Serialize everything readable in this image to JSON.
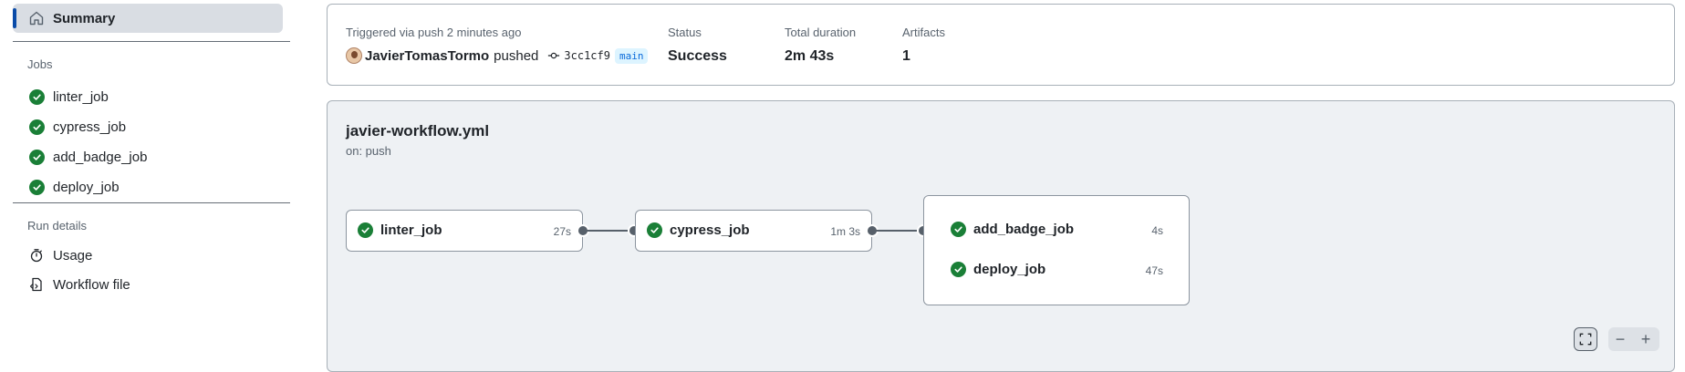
{
  "sidebar": {
    "summary_label": "Summary",
    "jobs_heading": "Jobs",
    "jobs": [
      {
        "label": "linter_job"
      },
      {
        "label": "cypress_job"
      },
      {
        "label": "add_badge_job"
      },
      {
        "label": "deploy_job"
      }
    ],
    "run_details_heading": "Run details",
    "run_details": [
      {
        "label": "Usage",
        "icon": "stopwatch-icon"
      },
      {
        "label": "Workflow file",
        "icon": "file-code-icon"
      }
    ]
  },
  "header": {
    "trigger_text": "Triggered via push 2 minutes ago",
    "actor": "JavierTomasTormo",
    "action": "pushed",
    "commit_sha": "3cc1cf9",
    "branch": "main",
    "status_label": "Status",
    "status_value": "Success",
    "duration_label": "Total duration",
    "duration_value": "2m 43s",
    "artifacts_label": "Artifacts",
    "artifacts_value": "1"
  },
  "graph": {
    "workflow_name": "javier-workflow.yml",
    "trigger": "on: push",
    "jobs": [
      {
        "name": "linter_job",
        "duration": "27s",
        "status": "success"
      },
      {
        "name": "cypress_job",
        "duration": "1m 3s",
        "status": "success"
      },
      {
        "name": "add_badge_job",
        "duration": "4s",
        "status": "success"
      },
      {
        "name": "deploy_job",
        "duration": "47s",
        "status": "success"
      }
    ],
    "controls": {
      "fullscreen": "fullscreen-icon",
      "zoom_out": "−",
      "zoom_in": "+"
    }
  },
  "colors": {
    "success": "#1a7f37",
    "accent": "#0a4ba8",
    "branch": "#0969da"
  }
}
